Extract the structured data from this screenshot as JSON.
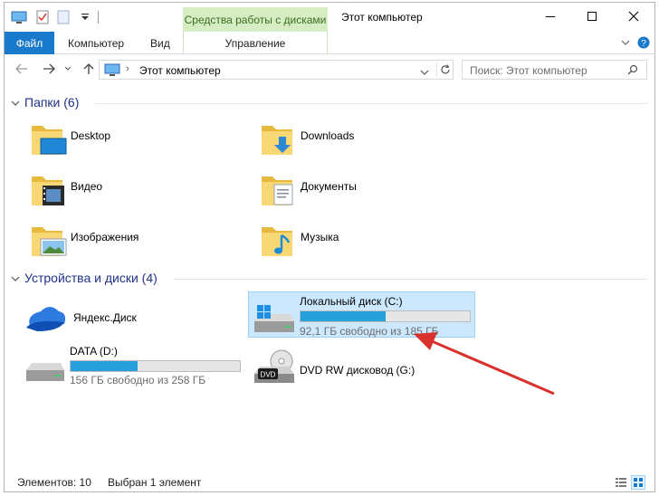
{
  "titlebar": {
    "contextual_tab_group": "Средства работы с дисками",
    "title": "Этот компьютер"
  },
  "ribbon": {
    "file_tab": "Файл",
    "tabs": [
      "Компьютер",
      "Вид"
    ],
    "contextual_tab": "Управление"
  },
  "address": {
    "path": "Этот компьютер",
    "search_placeholder": "Поиск: Этот компьютер"
  },
  "folders_group": {
    "title": "Папки (6)",
    "items": [
      {
        "label": "Desktop",
        "icon": "desktop-folder-icon"
      },
      {
        "label": "Downloads",
        "icon": "downloads-folder-icon"
      },
      {
        "label": "Видео",
        "icon": "videos-folder-icon"
      },
      {
        "label": "Документы",
        "icon": "documents-folder-icon"
      },
      {
        "label": "Изображения",
        "icon": "pictures-folder-icon"
      },
      {
        "label": "Музыка",
        "icon": "music-folder-icon"
      }
    ]
  },
  "devices_group": {
    "title": "Устройства и диски (4)",
    "items": [
      {
        "name": "Яндекс.Диск",
        "icon": "yandex-disk-icon"
      },
      {
        "name": "Локальный диск (C:)",
        "free": "92,1 ГБ свободно из 185 ГБ",
        "used_fraction": 0.502,
        "selected": true,
        "icon": "windows-drive-icon"
      },
      {
        "name": "DATA (D:)",
        "free": "156 ГБ свободно из 258 ГБ",
        "used_fraction": 0.395,
        "icon": "hard-drive-icon"
      },
      {
        "name": "DVD RW дисковод (G:)",
        "icon": "dvd-drive-icon"
      }
    ]
  },
  "status": {
    "items_count": "Элементов: 10",
    "selected": "Выбран 1 элемент"
  },
  "colors": {
    "accent": "#1979ca",
    "selection": "#cce8ff",
    "progress": "#26a0da",
    "contextual": "#d6edc4",
    "annotation_arrow": "#d9312b"
  }
}
